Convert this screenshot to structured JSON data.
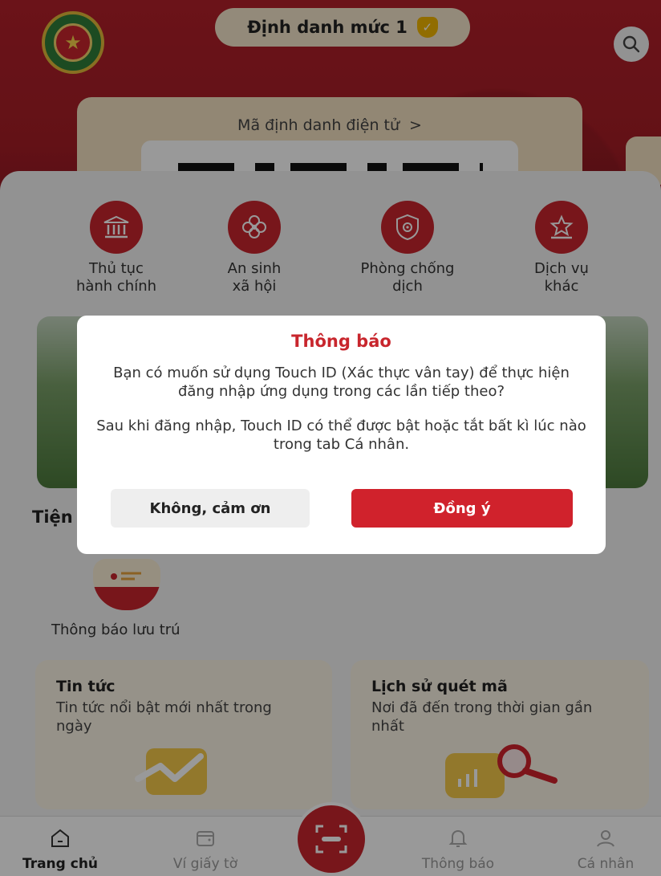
{
  "header": {
    "level_label": "Định danh mức 1",
    "emblem_icon": "police-emblem-icon",
    "search_icon": "search-icon",
    "id_card_title": "Mã định danh điện tử",
    "id_card_chevron": ">"
  },
  "services": [
    {
      "label_line1": "Thủ tục",
      "label_line2": "hành chính",
      "icon": "building-icon"
    },
    {
      "label_line1": "An sinh",
      "label_line2": "xã hội",
      "icon": "flower-icon"
    },
    {
      "label_line1": "Phòng chống",
      "label_line2": "dịch",
      "icon": "virus-shield-icon"
    },
    {
      "label_line1": "Dịch vụ",
      "label_line2": "khác",
      "icon": "star-icon"
    }
  ],
  "utilities": {
    "section_title": "Tiện",
    "feature_label": "Thông báo lưu trú"
  },
  "news_cards": [
    {
      "title": "Tin tức",
      "subtitle": "Tin tức nổi bật mới nhất trong ngày"
    },
    {
      "title": "Lịch sử quét mã",
      "subtitle": "Nơi đã đến trong thời gian gần nhất"
    }
  ],
  "bottom_nav": [
    {
      "label": "Trang chủ",
      "icon": "home-icon",
      "active": true
    },
    {
      "label": "Ví giấy tờ",
      "icon": "wallet-icon",
      "active": false
    },
    {
      "label": "Thông báo",
      "icon": "bell-icon",
      "active": false
    },
    {
      "label": "Cá nhân",
      "icon": "user-icon",
      "active": false
    }
  ],
  "dialog": {
    "title": "Thông báo",
    "paragraph1": "Bạn có muốn sử dụng Touch ID (Xác thực vân tay) để thực hiện đăng nhập ứng dụng trong các lần tiếp theo?",
    "paragraph2": "Sau khi đăng nhập, Touch ID có thể được bật hoặc tắt bất kì lúc nào trong tab Cá nhân.",
    "cancel_label": "Không, cảm ơn",
    "confirm_label": "Đồng ý"
  },
  "colors": {
    "brand_red": "#c8262d",
    "cream": "#f3e1c2",
    "badge_gold": "#f2b600"
  }
}
